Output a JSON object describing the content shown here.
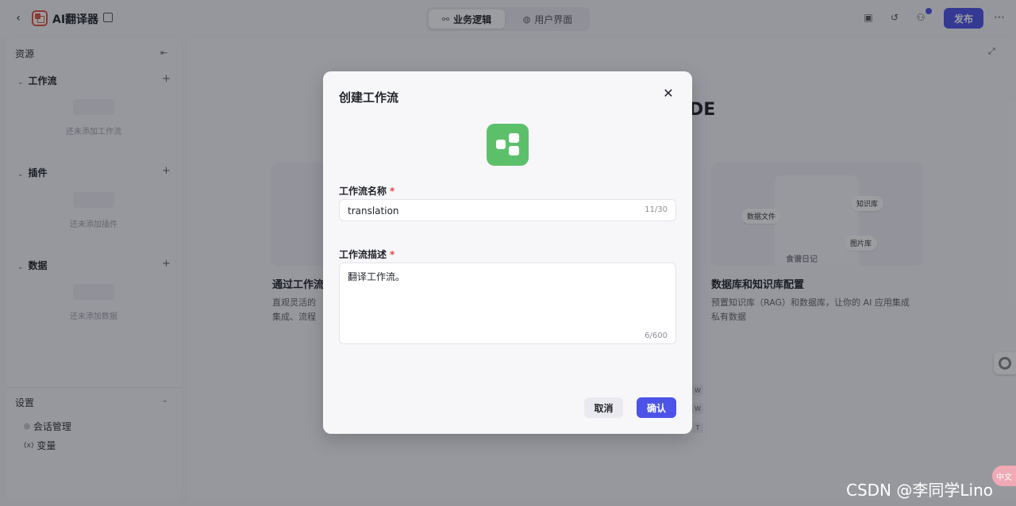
{
  "header": {
    "back_icon": "chevron-left-icon",
    "app_icon": "translate-icon",
    "app_name": "AI翻译器",
    "edit_icon": "edit-icon",
    "tabs": [
      {
        "label": "业务逻辑",
        "icon": "workflow-icon",
        "active": true
      },
      {
        "label": "用户界面",
        "icon": "palette-icon",
        "active": false
      }
    ],
    "publish_label": "发布",
    "accent_color": "#4d53e8"
  },
  "sidebar": {
    "title": "资源",
    "sections": [
      {
        "label": "工作流",
        "empty_text": "还未添加工作流"
      },
      {
        "label": "插件",
        "empty_text": "还未添加插件"
      },
      {
        "label": "数据",
        "empty_text": "还未添加数据"
      }
    ],
    "settings": {
      "label": "设置",
      "items": [
        {
          "label": "会话管理",
          "icon": "chat-icon"
        },
        {
          "label": "变量",
          "icon": "variable-icon"
        }
      ]
    }
  },
  "main": {
    "title_fragment": "DE",
    "cards": [
      {
        "heading": "通过工作流",
        "desc_line1": "直观灵活的",
        "desc_line2": "集成、流程"
      },
      {
        "heading": "数据库和知识库配置",
        "desc_line1": "预置知识库（RAG）和数据库，让你的 AI 应用集成",
        "desc_line2": "私有数据",
        "pills": [
          "数据文件",
          "知识库",
          "图片库"
        ],
        "phone_label": "食谱日记"
      }
    ]
  },
  "modal": {
    "title": "创建工作流",
    "name_label": "工作流名称",
    "name_value": "translation",
    "name_counter": "11/30",
    "desc_label": "工作流描述",
    "desc_value": "翻译工作流。",
    "desc_counter": "6/600",
    "required_mark": "*",
    "cancel_label": "取消",
    "confirm_label": "确认",
    "icon_color": "#5cc06a"
  },
  "watermark": "CSDN @李同学Lino",
  "corner_badge": "中文"
}
